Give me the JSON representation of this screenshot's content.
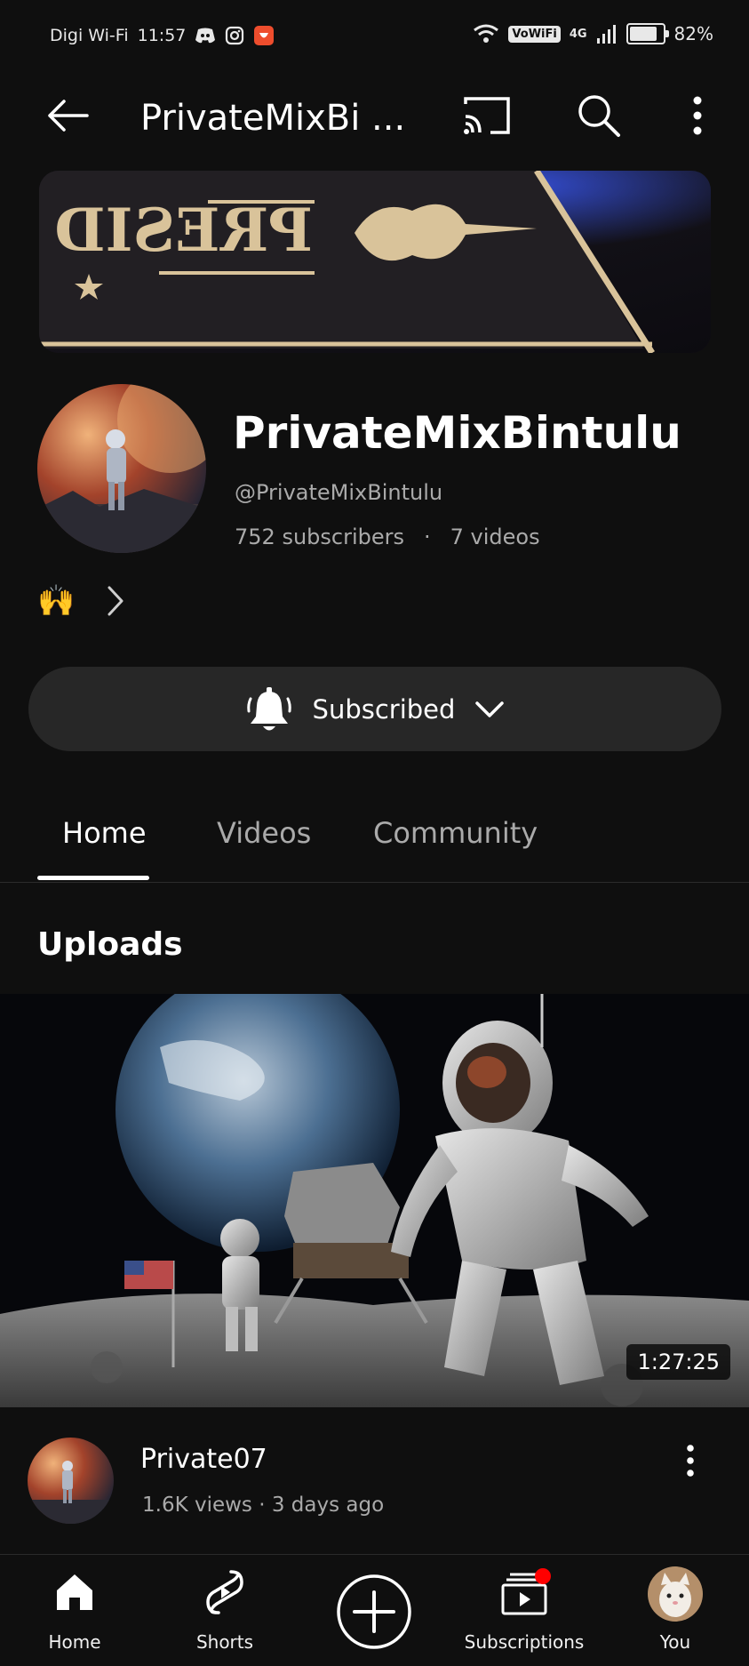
{
  "status_bar": {
    "carrier": "Digi Wi-Fi",
    "time": "11:57",
    "vowifi": "VoWiFi",
    "network": "4G",
    "battery": "82%"
  },
  "top_bar": {
    "title": "PrivateMixBi ..."
  },
  "channel": {
    "name": "PrivateMixBintulu",
    "handle": "@PrivateMixBintulu",
    "subscribers": "752 subscribers",
    "separator": "·",
    "videos": "7 videos",
    "description_emoji": "🙌",
    "banner_text": "PRESID"
  },
  "subscribe": {
    "label": "Subscribed"
  },
  "tabs": [
    {
      "label": "Home",
      "active": true
    },
    {
      "label": "Videos",
      "active": false
    },
    {
      "label": "Community",
      "active": false
    }
  ],
  "uploads": {
    "title": "Uploads",
    "video": {
      "duration": "1:27:25",
      "title": "Private07",
      "meta": "1.6K views · 3 days ago"
    }
  },
  "bottom_nav": [
    {
      "label": "Home"
    },
    {
      "label": "Shorts"
    },
    {
      "label": "Subscriptions"
    },
    {
      "label": "You"
    }
  ],
  "colors": {
    "background": "#0f0f0f",
    "button_bg": "#272727",
    "secondary_text": "#aaaaaa",
    "notification_dot": "#ff0000"
  }
}
